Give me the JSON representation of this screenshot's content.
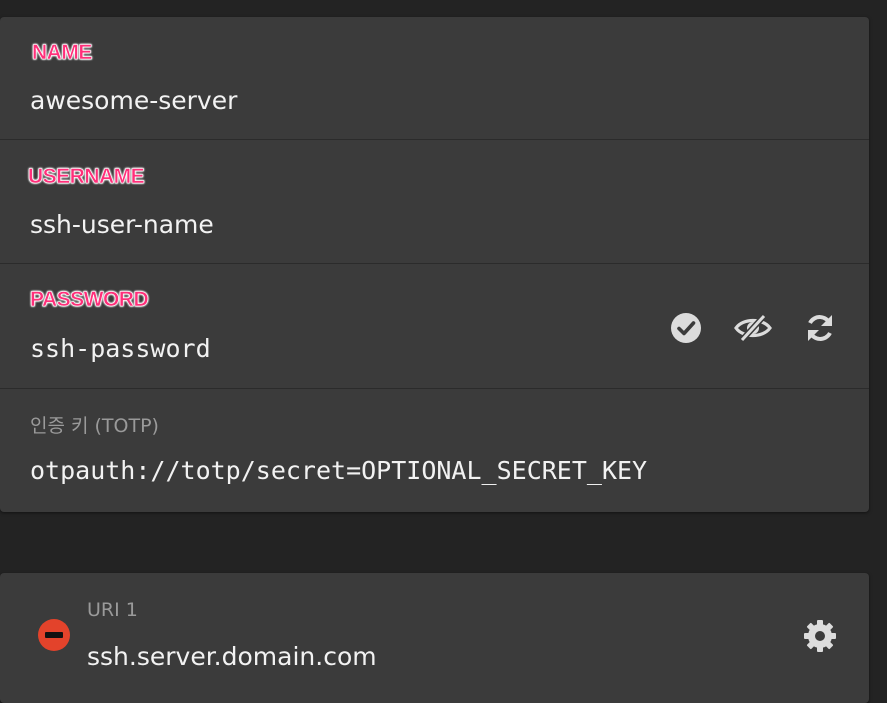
{
  "login": {
    "name": {
      "label": "NAME",
      "value": "awesome-server"
    },
    "username": {
      "label": "USERNAME",
      "value": "ssh-user-name"
    },
    "password": {
      "label": "PASSWORD",
      "value": "ssh-password",
      "actions": [
        {
          "icon": "check-circle-icon"
        },
        {
          "icon": "eye-slash-icon"
        },
        {
          "icon": "refresh-icon"
        }
      ]
    },
    "totp": {
      "label": "인증 키 (TOTP)",
      "value": "otpauth://totp/secret=OPTIONAL_SECRET_KEY"
    }
  },
  "uris": [
    {
      "label": "URI 1",
      "value": "ssh.server.domain.com",
      "remove_icon": "minus-circle-icon",
      "options_icon": "gear-icon"
    }
  ],
  "colors": {
    "background": "#232323",
    "card": "#3b3b3b",
    "highlight_label": "#ff2f7a",
    "remove": "#e3432b",
    "icon": "#dcdcdc"
  }
}
